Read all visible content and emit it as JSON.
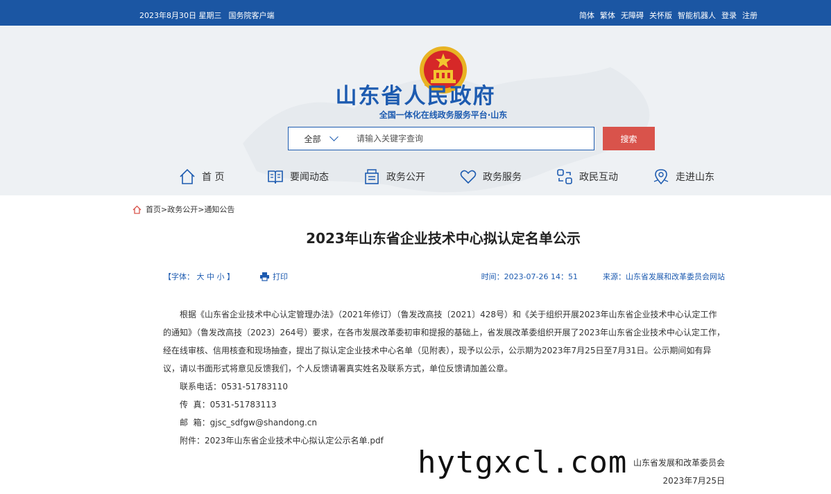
{
  "topbar": {
    "date": "2023年8月30日 星期三",
    "client": "国务院客户端",
    "links": [
      "简体",
      "繁体",
      "无障碍",
      "关怀版",
      "智能机器人",
      "登录",
      "注册"
    ]
  },
  "header": {
    "site_title": "山东省人民政府",
    "site_subtitle": "全国一体化在线政务服务平台·山东",
    "search": {
      "scope": "全部",
      "placeholder": "请输入关键字查询",
      "button": "搜索"
    }
  },
  "nav": [
    {
      "label": "首 页",
      "icon": "home-icon"
    },
    {
      "label": "要闻动态",
      "icon": "book-icon"
    },
    {
      "label": "政务公开",
      "icon": "document-icon"
    },
    {
      "label": "政务服务",
      "icon": "heart-icon"
    },
    {
      "label": "政民互动",
      "icon": "interaction-icon"
    },
    {
      "label": "走进山东",
      "icon": "location-icon"
    }
  ],
  "breadcrumb": {
    "home": "首页",
    "sep1": ">",
    "level1": "政务公开",
    "sep2": ">",
    "level2": "通知公告"
  },
  "article": {
    "title": "2023年山东省企业技术中心拟认定名单公示",
    "font_prefix": "【字体：",
    "font_sizes": [
      "大",
      "中",
      "小"
    ],
    "font_suffix": "】",
    "print": "打印",
    "time": "时间：2023-07-26 14：51",
    "source": "来源：山东省发展和改革委员会网站",
    "paragraph": "根据《山东省企业技术中心认定管理办法》（2021年修订）（鲁发改高技〔2021〕428号）和《关于组织开展2023年山东省企业技术中心认定工作的通知》（鲁发改高技〔2023〕264号）要求，在各市发展改革委初审和提报的基础上，省发展改革委组织开展了2023年山东省企业技术中心认定工作，经在线审核、信用核查和现场抽查，提出了拟认定企业技术中心名单（见附表），现予以公示，公示期为2023年7月25日至7月31日。公示期间如有异议，请以书面形式将意见反馈我们，个人反馈请署真实姓名及联系方式，单位反馈请加盖公章。",
    "phone": "联系电话：0531-51783110",
    "fax": "传  真：0531-51783113",
    "email": "邮  箱：gjsc_sdfgw@shandong.cn",
    "attachment": "附件：2023年山东省企业技术中心拟认定公示名单.pdf",
    "signer": "山东省发展和改革委员会",
    "sign_date": "2023年7月25日"
  },
  "watermark": "hytgxcl.com",
  "colors": {
    "brand_blue": "#1b56a3",
    "search_red": "#d9534b"
  }
}
